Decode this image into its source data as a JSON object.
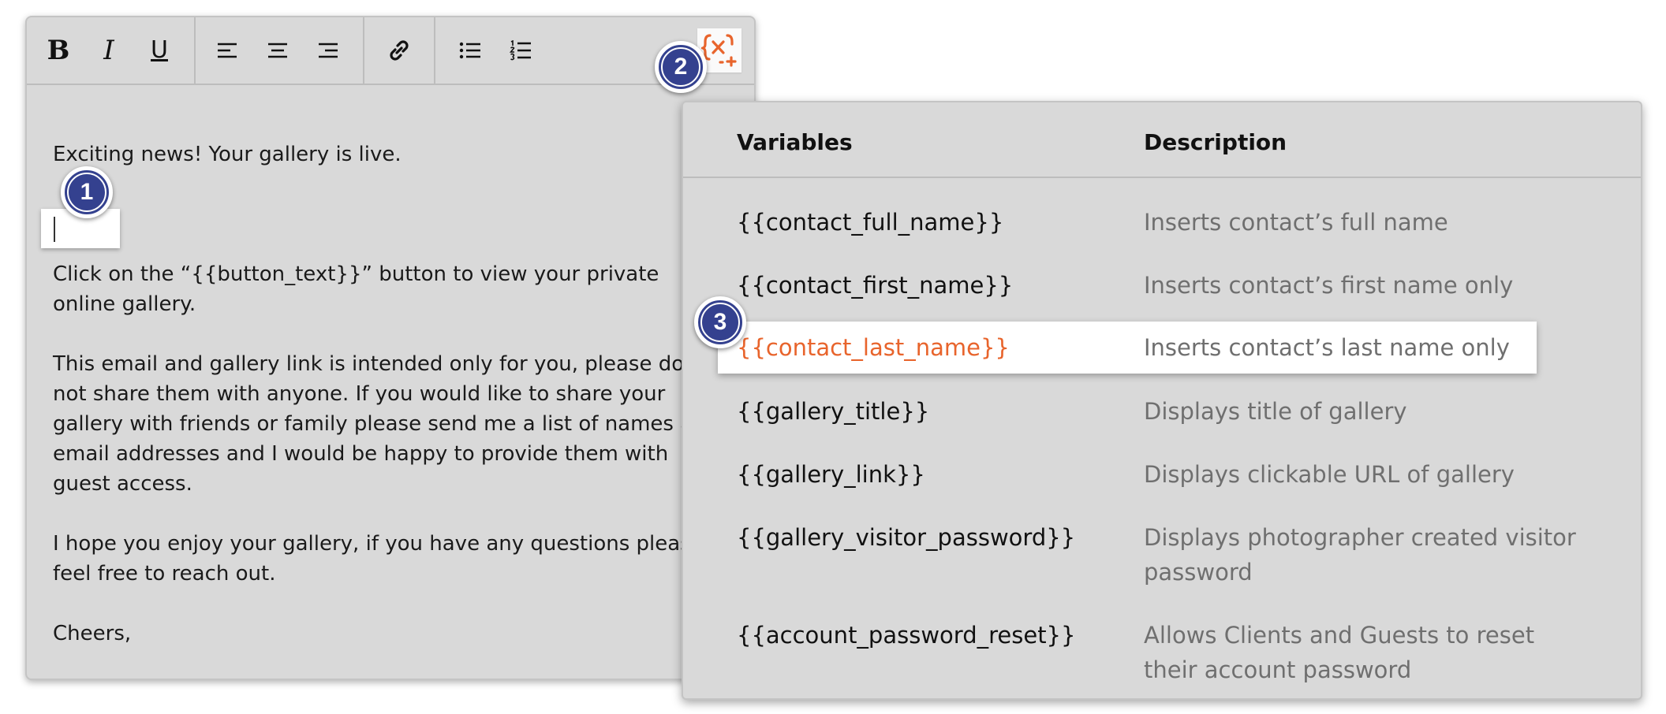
{
  "toolbar": {
    "bold": "B",
    "italic": "I",
    "underline": "U",
    "icons": [
      "align-left-icon",
      "align-center-icon",
      "align-right-icon",
      "link-icon",
      "bullet-list-icon",
      "numbered-list-icon",
      "insert-variable-icon"
    ]
  },
  "editor": {
    "paragraphs": [
      "Exciting news! Your gallery is live.",
      "Click on the “{{button_text}}” button to view your private online gallery.",
      "This email and gallery link is intended only for you, please do not share them with anyone. If you would like to share your gallery with friends or family please send me a list of names and email addresses and I would be happy to provide them with guest access.",
      "I hope you enjoy your gallery, if you have any questions please feel free to reach out.",
      "Cheers,"
    ]
  },
  "popup": {
    "header_variables": "Variables",
    "header_description": "Description",
    "rows": [
      {
        "var": "{{contact_full_name}}",
        "desc": "Inserts contact’s full name"
      },
      {
        "var": "{{contact_first_name}}",
        "desc": "Inserts contact’s first name only"
      },
      {
        "var": "{{contact_last_name}}",
        "desc": "Inserts contact’s last name only"
      },
      {
        "var": "{{gallery_title}}",
        "desc": "Displays title of gallery"
      },
      {
        "var": "{{gallery_link}}",
        "desc": "Displays clickable URL of gallery"
      },
      {
        "var": "{{gallery_visitor_password}}",
        "desc": "Displays photographer created visitor password"
      },
      {
        "var": "{{account_password_reset}}",
        "desc": "Allows Clients and Guests to reset their account password"
      }
    ]
  },
  "callouts": [
    "1",
    "2",
    "3"
  ],
  "colors": {
    "accent": "#e8642c",
    "badge": "#34418f",
    "panel": "#d9d9d9"
  }
}
